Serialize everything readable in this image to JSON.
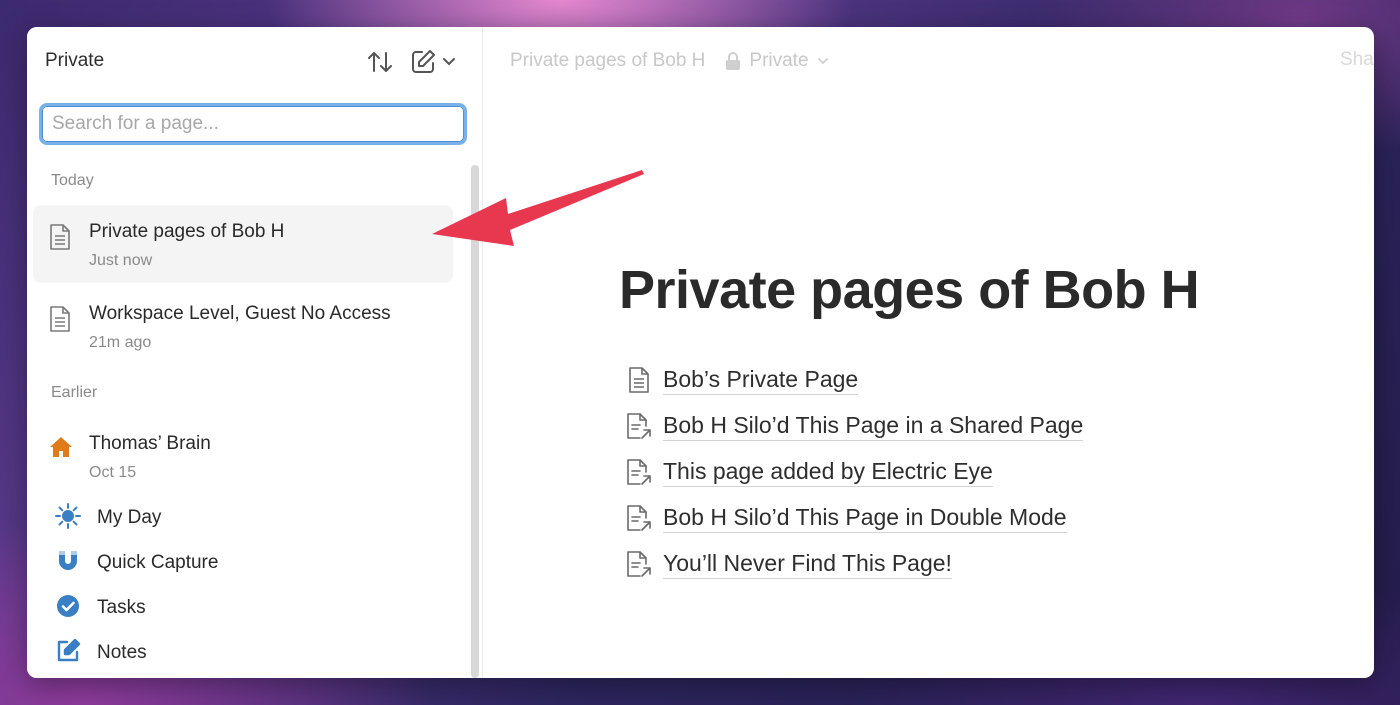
{
  "sidebar": {
    "title": "Private",
    "search_placeholder": "Search for a page...",
    "sections": {
      "today": "Today",
      "earlier": "Earlier"
    },
    "pages": [
      {
        "title": "Private pages of Bob H",
        "time": "Just now",
        "icon": "page-icon",
        "active": true
      },
      {
        "title": "Workspace Level, Guest No Access",
        "time": "21m ago",
        "icon": "page-icon",
        "active": false
      },
      {
        "title": "Thomas’ Brain",
        "time": "Oct 15",
        "icon": "house-icon",
        "active": false
      }
    ],
    "nav": [
      {
        "label": "My Day",
        "icon": "sun-icon"
      },
      {
        "label": "Quick Capture",
        "icon": "magnet-icon"
      },
      {
        "label": "Tasks",
        "icon": "check-circle-icon"
      },
      {
        "label": "Notes",
        "icon": "edit-note-icon"
      }
    ]
  },
  "topbar": {
    "breadcrumb": "Private pages of Bob H",
    "privacy": "Private",
    "share": "Share"
  },
  "main": {
    "title": "Private pages of Bob H",
    "links": [
      {
        "label": "Bob’s Private Page",
        "icon": "page-icon"
      },
      {
        "label": "Bob H Silo’d This Page in a Shared Page",
        "icon": "page-link-icon"
      },
      {
        "label": "This page added by Electric Eye",
        "icon": "page-link-icon"
      },
      {
        "label": "Bob H Silo’d This Page in Double Mode",
        "icon": "page-link-icon"
      },
      {
        "label": "You’ll Never Find This Page!",
        "icon": "page-link-icon"
      }
    ]
  },
  "colors": {
    "accent_house": "#e07b1a",
    "accent_blue": "#3a7fc4",
    "arrow_red": "#e8384f",
    "focus_ring": "#7ab0e8"
  }
}
